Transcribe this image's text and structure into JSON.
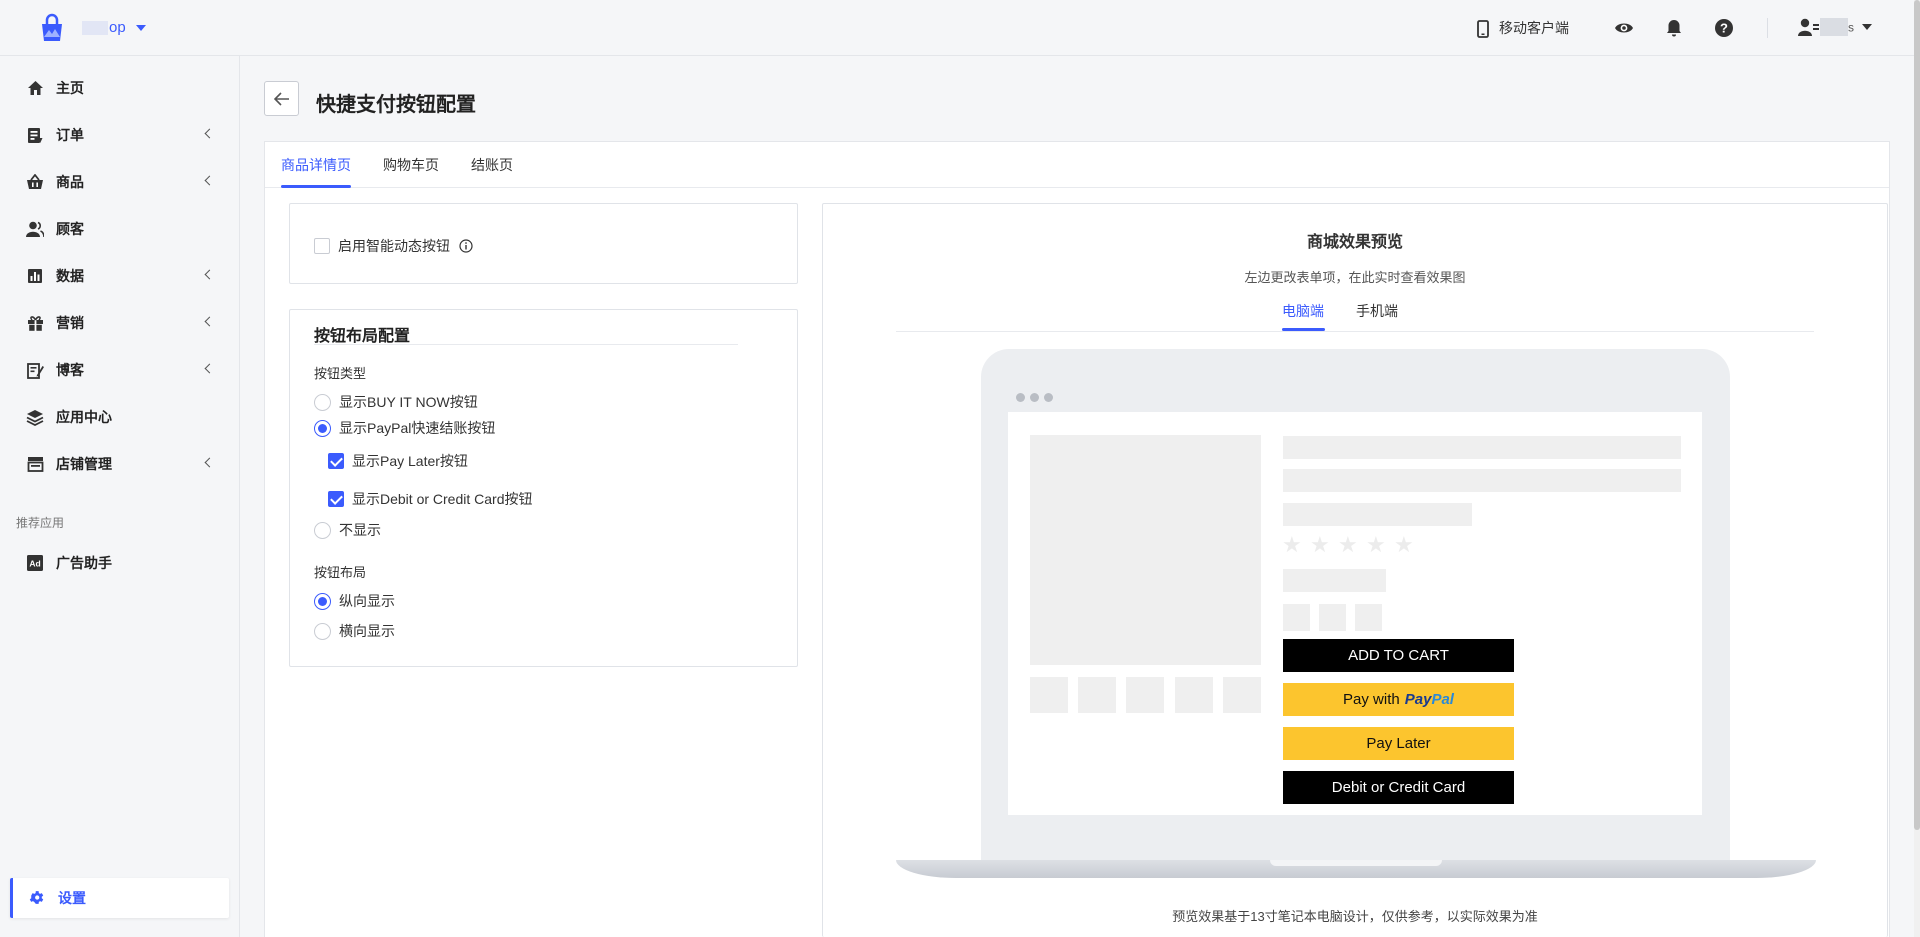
{
  "app": {
    "shop_name_suffix": "op"
  },
  "header": {
    "mobile_client": "移动客户端",
    "user_suffix": "s"
  },
  "sidebar": {
    "items": [
      {
        "label": "主页",
        "icon": "home-icon",
        "expandable": false
      },
      {
        "label": "订单",
        "icon": "orders-icon",
        "expandable": true
      },
      {
        "label": "商品",
        "icon": "basket-icon",
        "expandable": true
      },
      {
        "label": "顾客",
        "icon": "customers-icon",
        "expandable": false
      },
      {
        "label": "数据",
        "icon": "bar-chart-icon",
        "expandable": true
      },
      {
        "label": "营销",
        "icon": "gift-icon",
        "expandable": true
      },
      {
        "label": "博客",
        "icon": "blog-icon",
        "expandable": true
      },
      {
        "label": "应用中心",
        "icon": "layers-icon",
        "expandable": false
      },
      {
        "label": "店铺管理",
        "icon": "store-icon",
        "expandable": true
      }
    ],
    "section_label": "推荐应用",
    "recommended": [
      {
        "label": "广告助手",
        "icon": "ad-icon"
      }
    ],
    "settings": {
      "label": "设置",
      "icon": "gear-icon"
    }
  },
  "page": {
    "title": "快捷支付按钮配置",
    "tabs": [
      "商品详情页",
      "购物车页",
      "结账页"
    ],
    "active_tab": 0
  },
  "form": {
    "smart_button_label": "启用智能动态按钮",
    "smart_button_checked": false,
    "layout_section_title": "按钮布局配置",
    "button_type_label": "按钮类型",
    "button_type_options": [
      {
        "label": "显示BUY IT NOW按钮",
        "selected": false
      },
      {
        "label": "显示PayPal快速结账按钮",
        "selected": true
      },
      {
        "label": "不显示",
        "selected": false
      }
    ],
    "paypal_suboptions": [
      {
        "label": "显示Pay Later按钮",
        "checked": true
      },
      {
        "label": "显示Debit or Credit Card按钮",
        "checked": true
      }
    ],
    "layout_label": "按钮布局",
    "layout_options": [
      {
        "label": "纵向显示",
        "selected": true
      },
      {
        "label": "横向显示",
        "selected": false
      }
    ]
  },
  "preview": {
    "title": "商城效果预览",
    "subtitle": "左边更改表单项，在此实时查看效果图",
    "tabs": [
      "电脑端",
      "手机端"
    ],
    "active_tab": 0,
    "buttons": {
      "add_to_cart": "ADD TO CART",
      "pay_with": "Pay with",
      "paypal_1": "Pay",
      "paypal_2": "Pal",
      "pay_later": "Pay Later",
      "debit_credit": "Debit or Credit Card"
    },
    "footnote": "预览效果基于13寸笔记本电脑设计，仅供参考，以实际效果为准"
  },
  "colors": {
    "accent": "#3b5bfd",
    "paypal_yellow": "#fcc52e",
    "paypal_dark_blue": "#1a3a8f",
    "paypal_light_blue": "#2a8ad8"
  }
}
